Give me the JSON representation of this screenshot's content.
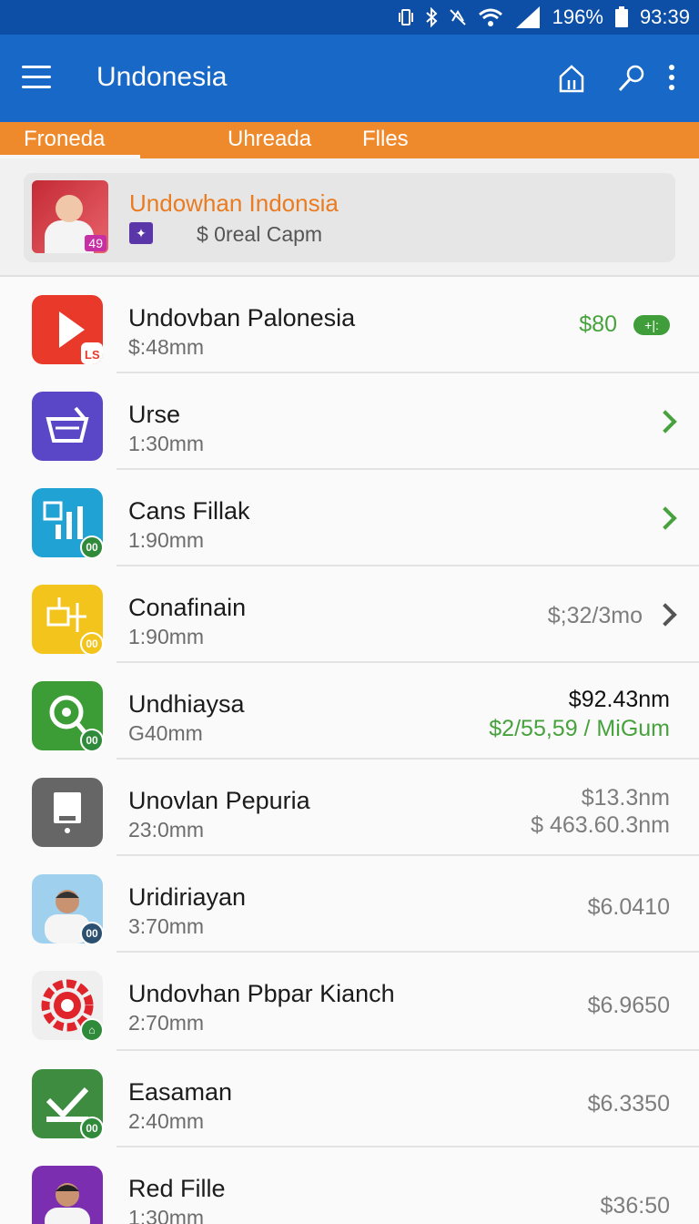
{
  "status_bar": {
    "battery": "196%",
    "time": "93:39"
  },
  "app_bar": {
    "title": "Undonesia"
  },
  "tabs": [
    {
      "label": "Froneda"
    },
    {
      "label": "Uhreada"
    },
    {
      "label": "Flles"
    }
  ],
  "featured": {
    "title": "Undowhan Indonsia",
    "subtitle": "$ 0real Capm",
    "badge": "49"
  },
  "items": [
    {
      "name": "Undovban Palonesia",
      "size": "$:48mm",
      "value": "$80",
      "value_color": "#47a23d",
      "icon": "play-icon",
      "icon_color": "#e8392b"
    },
    {
      "name": "Urse",
      "size": "1:30mm",
      "icon": "basket-icon",
      "icon_color": "#5a47c7"
    },
    {
      "name": "Cans Fillak",
      "size": "1:90mm",
      "badge": "00",
      "icon": "chart-icon",
      "icon_color": "#20a2d4"
    },
    {
      "name": "Conafinain",
      "size": "1:90mm",
      "value": "$;32/3mo",
      "badge": "00",
      "icon": "circuit-icon",
      "icon_color": "#f3c41c"
    },
    {
      "name": "Undhiaysa",
      "size": "G40mm",
      "value": "$92.43nm",
      "value2": "$2/55,59 / MiGum",
      "badge": "00",
      "icon": "chat-icon",
      "icon_color": "#3c9c35"
    },
    {
      "name": "Unovlan Pepuria",
      "size": "23:0mm",
      "value": "$13.3nm",
      "value2": "$ 463.60.3nm",
      "icon": "device-icon",
      "icon_color": "#666666"
    },
    {
      "name": "Uridiriayan",
      "size": "3:70mm",
      "value": "$6.0410",
      "badge": "00",
      "icon": "avatar-icon",
      "icon_color": "#9fd0ee"
    },
    {
      "name": "Undovhan Pbpar Kianch",
      "size": "2:70mm",
      "value": "$6.9650",
      "icon": "gear-icon",
      "icon_color": "#e0242c"
    },
    {
      "name": "Easaman",
      "size": "2:40mm",
      "value": "$6.3350",
      "badge": "00",
      "icon": "download-icon",
      "icon_color": "#3d8c3f"
    },
    {
      "name": "Red Fille",
      "size": "1:30mm",
      "value": "$36:50",
      "icon": "avatar-icon",
      "icon_color": "#7b2fb0"
    }
  ]
}
